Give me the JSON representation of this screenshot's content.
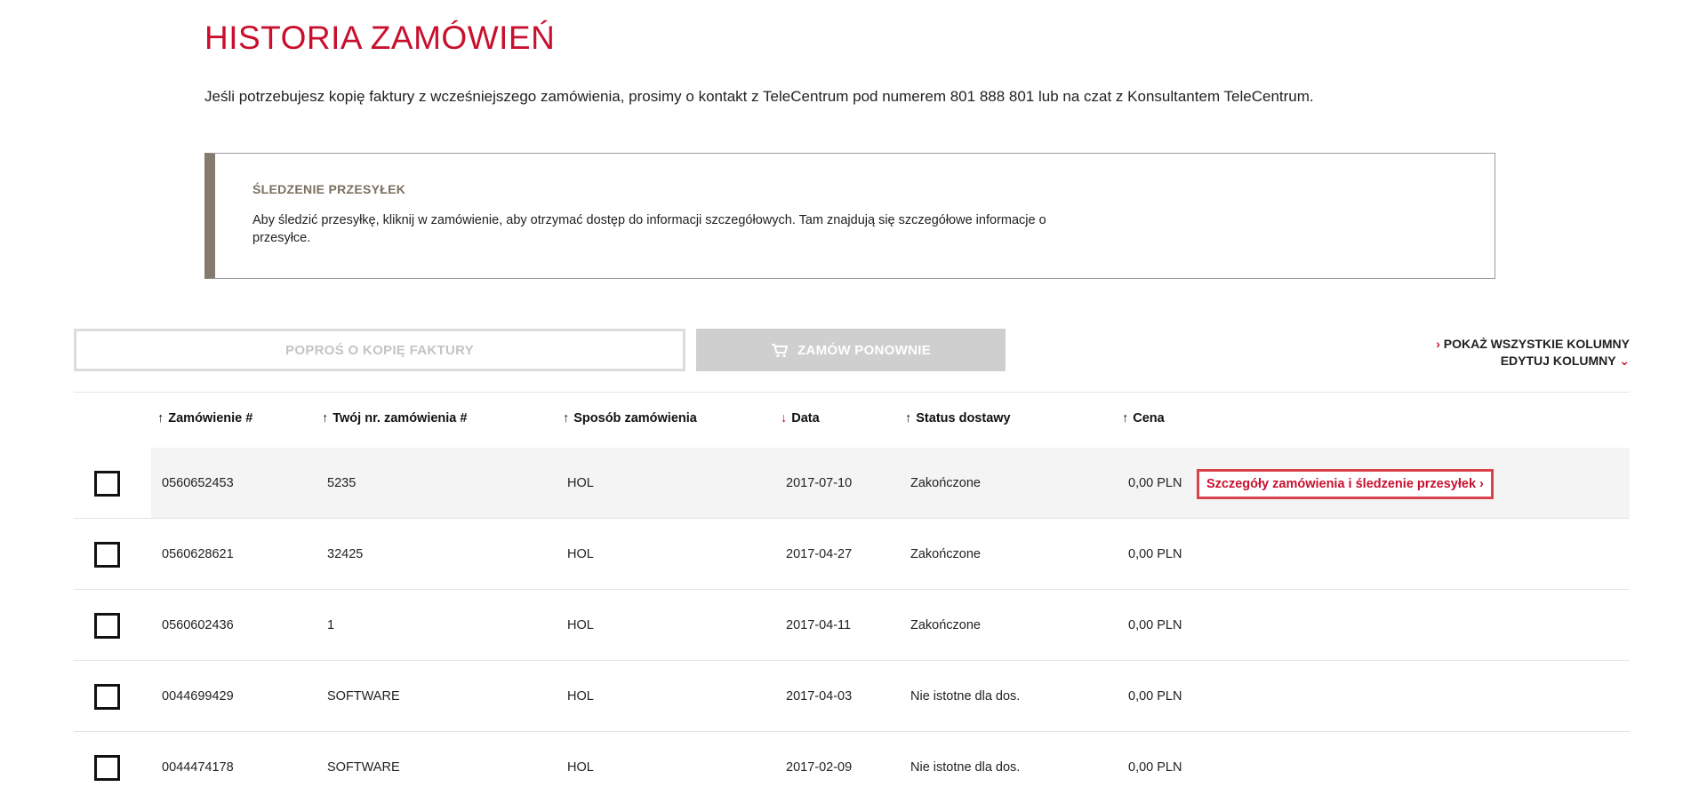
{
  "page": {
    "title": "HISTORIA ZAMÓWIEŃ",
    "intro": "Jeśli potrzebujesz kopię faktury z wcześniejszego zamówienia, prosimy o kontakt z TeleCentrum pod numerem 801 888 801 lub na czat z Konsultantem TeleCentrum."
  },
  "notice": {
    "title": "ŚLEDZENIE PRZESYŁEK",
    "text": "Aby śledzić przesyłkę, kliknij w zamówienie, aby otrzymać dostęp do informacji szczegółowych. Tam znajdują się szczegółowe informacje o przesyłce."
  },
  "actions": {
    "invoice_label": "POPROŚ O KOPIĘ FAKTURY",
    "reorder_label": "ZAMÓW PONOWNIE",
    "reorder_icon": "cart-icon",
    "show_all_columns": "POKAŻ WSZYSTKIE KOLUMNY",
    "edit_columns": "EDYTUJ KOLUMNY",
    "show_all_prefix": "›",
    "edit_suffix": "⌄"
  },
  "colors": {
    "accent": "#c8102e",
    "highlight_row": "#f4f4f4",
    "notice_bar": "#847b6e"
  },
  "table": {
    "headers": [
      {
        "label": "Zamówienie #",
        "arrow": "↑",
        "sorted": false
      },
      {
        "label": "Twój nr. zamówienia #",
        "arrow": "↑",
        "sorted": false
      },
      {
        "label": "Sposób zamówienia",
        "arrow": "↑",
        "sorted": false
      },
      {
        "label": "Data",
        "arrow": "↓",
        "sorted": true
      },
      {
        "label": "Status dostawy",
        "arrow": "↑",
        "sorted": false
      },
      {
        "label": "Cena",
        "arrow": "↑",
        "sorted": false
      }
    ],
    "rows": [
      {
        "order": "0560652453",
        "your_no": "5235",
        "method": "HOL",
        "date": "2017-07-10",
        "status": "Zakończone",
        "price": "0,00 PLN",
        "checked": false,
        "highlight": true
      },
      {
        "order": "0560628621",
        "your_no": "32425",
        "method": "HOL",
        "date": "2017-04-27",
        "status": "Zakończone",
        "price": "0,00 PLN",
        "checked": false,
        "highlight": false
      },
      {
        "order": "0560602436",
        "your_no": "1",
        "method": "HOL",
        "date": "2017-04-11",
        "status": "Zakończone",
        "price": "0,00 PLN",
        "checked": false,
        "highlight": false
      },
      {
        "order": "0044699429",
        "your_no": "SOFTWARE",
        "method": "HOL",
        "date": "2017-04-03",
        "status": "Nie istotne dla dos.",
        "price": "0,00 PLN",
        "checked": false,
        "highlight": false
      },
      {
        "order": "0044474178",
        "your_no": "SOFTWARE",
        "method": "HOL",
        "date": "2017-02-09",
        "status": "Nie istotne dla dos.",
        "price": "0,00 PLN",
        "checked": false,
        "highlight": false
      }
    ],
    "detail_link": "Szczegóły zamówienia i śledzenie przesyłek ›"
  }
}
